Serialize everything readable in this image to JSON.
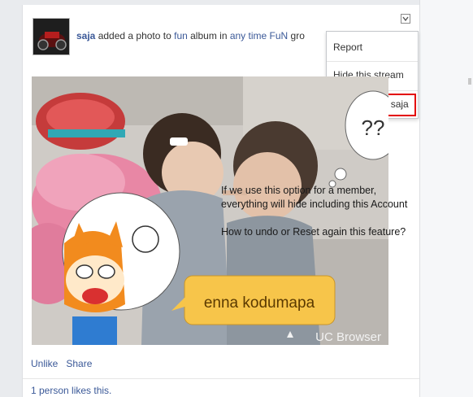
{
  "post": {
    "author": "saja",
    "action_text": " added a photo to ",
    "album": "fun",
    "album_suffix": " album in ",
    "group": "any time FuN",
    "group_suffix": " gro"
  },
  "menu": {
    "items": [
      "Report",
      "Hide this stream",
      "Hide all from saja"
    ]
  },
  "image": {
    "thought_bubble": "??",
    "speech_bubble": "enna kodumapa",
    "watermark": "UC Browser"
  },
  "annotation": {
    "line1": "If we use this option for a member,",
    "line2": "everything will hide including this  Account",
    "line3": "How to undo or Reset again this feature?"
  },
  "actions": {
    "unlike": "Unlike",
    "share": "Share"
  },
  "likes_text": "1 person likes this.",
  "colors": {
    "link": "#3b5998",
    "highlight": "#e30000"
  }
}
